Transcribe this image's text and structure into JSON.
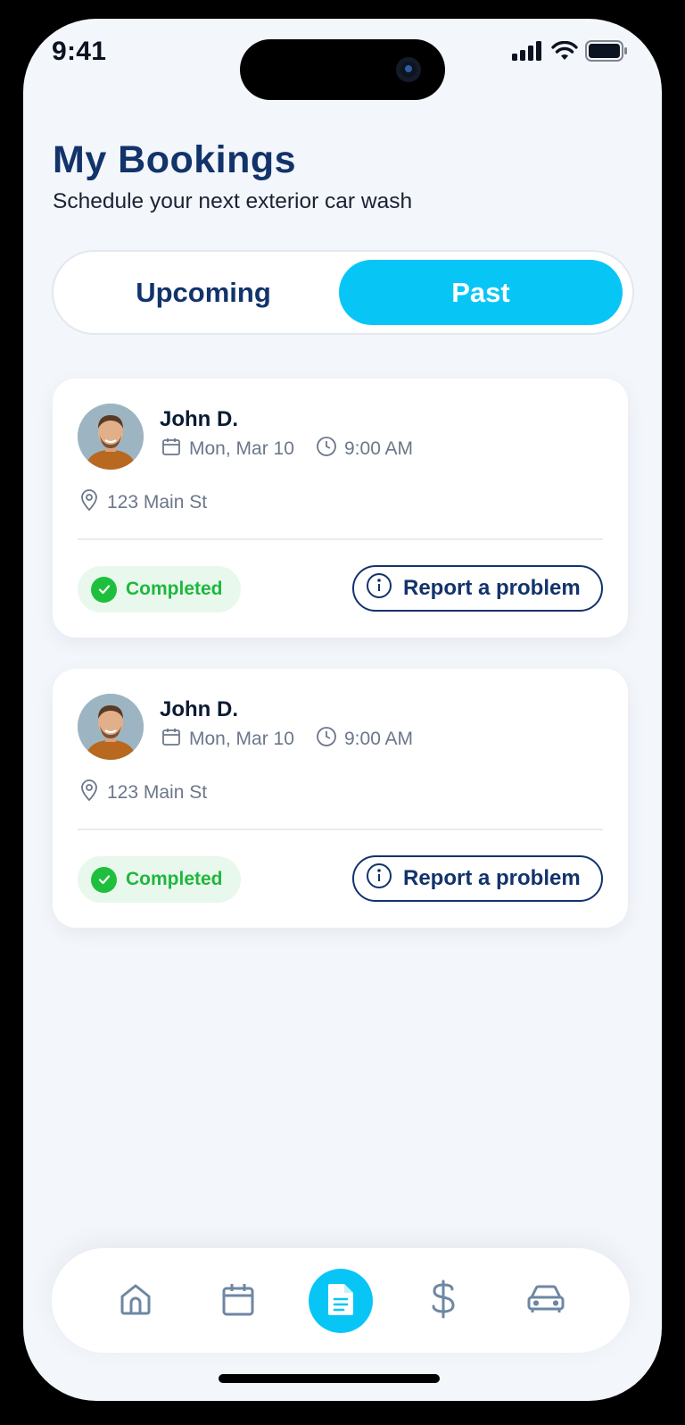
{
  "status_bar": {
    "time": "9:41"
  },
  "header": {
    "title": "My Bookings",
    "subtitle": "Schedule your next exterior car wash"
  },
  "tabs": {
    "upcoming_label": "Upcoming",
    "past_label": "Past",
    "active": "Past"
  },
  "bookings": [
    {
      "name": "John D.",
      "date": "Mon, Mar 10",
      "time": "9:00 AM",
      "address": "123 Main St",
      "status": "Completed",
      "action_label": "Report a problem"
    },
    {
      "name": "John D.",
      "date": "Mon, Mar 10",
      "time": "9:00 AM",
      "address": "123 Main St",
      "status": "Completed",
      "action_label": "Report a problem"
    }
  ],
  "bottom_nav": {
    "items": [
      "home-icon",
      "calendar-icon",
      "document-icon",
      "dollar-icon",
      "car-icon"
    ],
    "active": "document-icon"
  },
  "colors": {
    "brand_navy": "#12336B",
    "accent_cyan": "#07C6F6",
    "success_green": "#1FBF3E",
    "muted_text": "#6B778A"
  }
}
